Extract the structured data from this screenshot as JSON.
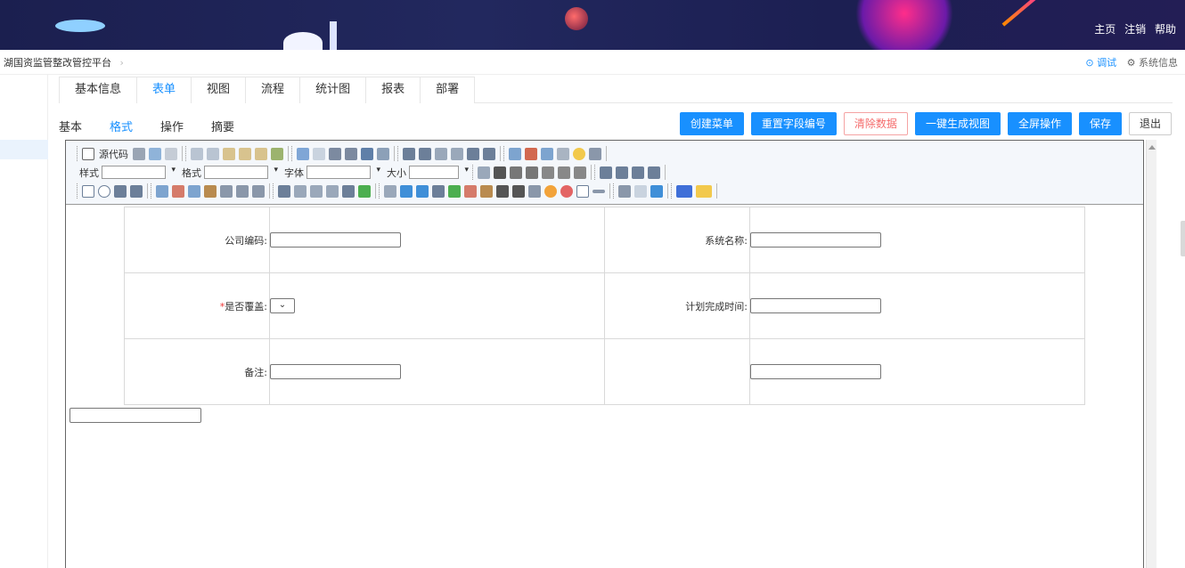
{
  "header": {
    "links": [
      "主页",
      "注销",
      "帮助"
    ]
  },
  "breadcrumb": {
    "platform": "湖国资监管整改管控平台",
    "separator": "›",
    "debug_label": "⊙ 调试",
    "sysinfo_label": "⚙ 系统信息"
  },
  "tabs": [
    "基本信息",
    "表单",
    "视图",
    "流程",
    "统计图",
    "报表",
    "部署"
  ],
  "active_tab": "表单",
  "subtabs": [
    "基本",
    "格式",
    "操作",
    "摘要"
  ],
  "active_subtab": "格式",
  "actions": [
    "创建菜单",
    "重置字段编号",
    "清除数据",
    "一键生成视图",
    "全屏操作",
    "保存",
    "退出"
  ],
  "toolbar": {
    "source_label": "源代码",
    "style_label": "样式",
    "format_label": "格式",
    "font_label": "字体",
    "size_label": "大小"
  },
  "form": {
    "company_code_label": "公司编码:",
    "system_name_label": "系统名称:",
    "is_covered_label": "是否覆盖:",
    "is_covered_required": "*",
    "plan_date_label": "计划完成时间:",
    "remark_label": "备注:"
  },
  "colors": {
    "primary": "#1890ff",
    "danger": "#f56c6c",
    "banner": "#1b1f4f"
  }
}
